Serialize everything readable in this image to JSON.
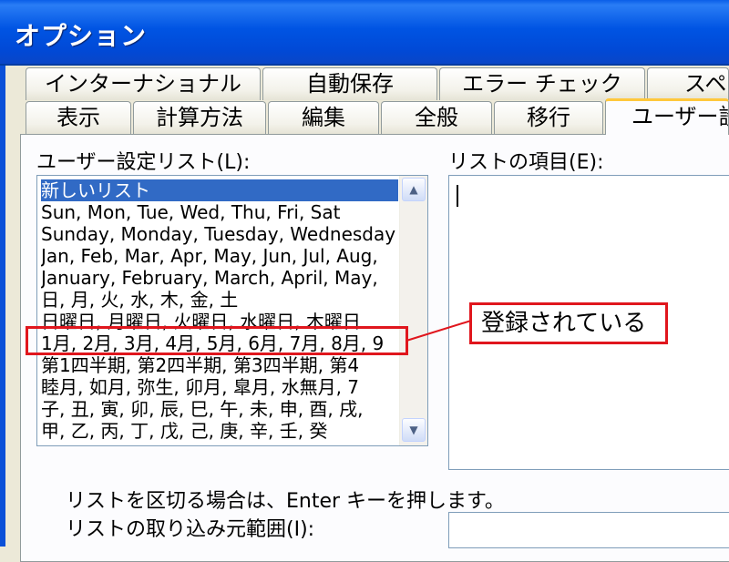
{
  "window": {
    "title": "オプション"
  },
  "tabs_back": [
    {
      "label": "インターナショナル"
    },
    {
      "label": "自動保存"
    },
    {
      "label": "エラー チェック"
    },
    {
      "label": "スペ"
    }
  ],
  "tabs_front": [
    {
      "label": "表示"
    },
    {
      "label": "計算方法"
    },
    {
      "label": "編集"
    },
    {
      "label": "全般"
    },
    {
      "label": "移行"
    },
    {
      "label": "ユーザー設定",
      "active": true
    }
  ],
  "custom_lists": {
    "label": "ユーザー設定リスト(L):",
    "items": [
      "新しいリスト",
      "Sun, Mon, Tue, Wed, Thu, Fri, Sat",
      "Sunday, Monday, Tuesday, Wednesday",
      "Jan, Feb, Mar, Apr, May, Jun, Jul, Aug,",
      "January, February, March, April, May,",
      "日, 月, 火, 水, 木, 金, 土",
      "日曜日, 月曜日, 火曜日, 水曜日, 木曜日",
      "1月, 2月, 3月, 4月, 5月, 6月, 7月, 8月, 9",
      "第1四半期, 第2四半期, 第3四半期, 第4",
      "睦月, 如月, 弥生, 卯月, 皐月, 水無月, 7",
      "子, 丑, 寅, 卯, 辰, 巳, 午, 未, 申, 酉, 戌,",
      "甲, 乙, 丙, 丁, 戊, 己, 庚, 辛, 壬, 癸"
    ],
    "selected_index": 0,
    "highlighted_index": 7
  },
  "list_entries": {
    "label": "リストの項目(E):",
    "value": ""
  },
  "callout": {
    "text": "登録されている"
  },
  "hint": {
    "text": "リストを区切る場合は、Enter キーを押します。"
  },
  "import_range": {
    "label": "リストの取り込み元範囲(I):",
    "value": ""
  },
  "colors": {
    "accent": "#0054e3",
    "selection": "#316ac5",
    "annotation": "#e0161d"
  }
}
